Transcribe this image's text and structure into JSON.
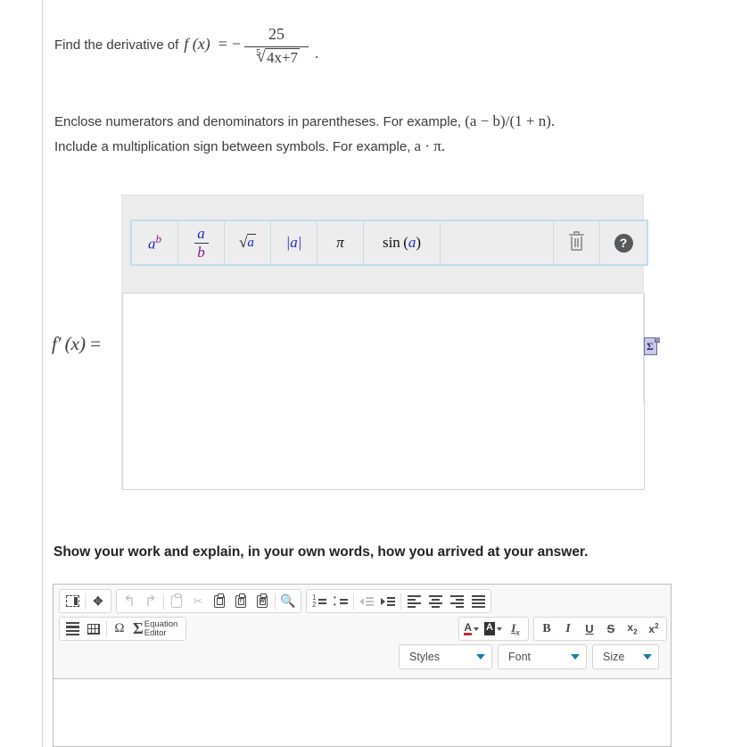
{
  "prompt": {
    "lead": "Find the derivative of",
    "function_name": "f (x)",
    "equals": "=",
    "minus": "−",
    "numerator": "25",
    "root_index": "5",
    "radicand": "4x+7",
    "period": "."
  },
  "instructions": {
    "line1_a": "Enclose numerators and denominators in parentheses. For example,",
    "line1_math": "(a − b)/(1 + n).",
    "line2_a": "Include a multiplication sign between symbols. For example,",
    "line2_math": "a · π."
  },
  "math_toolbar": {
    "buttons": [
      {
        "name": "power-button",
        "base": "a",
        "exp": "b"
      },
      {
        "name": "fraction-button",
        "num": "a",
        "den": "b"
      },
      {
        "name": "sqrt-button",
        "radicand": "a"
      },
      {
        "name": "absolute-value-button",
        "label": "|a|"
      },
      {
        "name": "pi-button",
        "label": "π"
      },
      {
        "name": "sine-button",
        "fn": "sin",
        "arg": "a"
      }
    ],
    "trash_label": "trash-icon",
    "help_label": "?"
  },
  "answer": {
    "label_f": "f",
    "label_prime": "′",
    "label_x": "(x)",
    "label_eq": "=",
    "value": "",
    "sigma_icon": "Σ"
  },
  "work": {
    "heading": "Show your work and explain, in your own words, how you arrived at your answer."
  },
  "editor": {
    "row1": [
      {
        "name": "source-button",
        "icon": "source"
      },
      {
        "name": "maximize-button",
        "icon": "maximize"
      },
      {
        "name": "undo-button",
        "icon": "←",
        "disabled": true
      },
      {
        "name": "redo-button",
        "icon": "→",
        "disabled": true
      },
      {
        "name": "copy-button",
        "icon": "copy",
        "disabled": true
      },
      {
        "name": "cut-button",
        "icon": "✂",
        "disabled": true
      },
      {
        "name": "paste-button",
        "icon": "paste"
      },
      {
        "name": "paste-as-text-button",
        "icon": "T"
      },
      {
        "name": "paste-from-word-button",
        "icon": "W"
      },
      {
        "name": "find-button",
        "icon": "🔍"
      },
      {
        "name": "numbered-list-button",
        "icon": "ol"
      },
      {
        "name": "bulleted-list-button",
        "icon": "ul"
      },
      {
        "name": "decrease-indent-button",
        "icon": "outdent",
        "disabled": true
      },
      {
        "name": "increase-indent-button",
        "icon": "indent"
      },
      {
        "name": "align-left-button",
        "icon": "align-left"
      },
      {
        "name": "align-center-button",
        "icon": "align-center"
      },
      {
        "name": "align-right-button",
        "icon": "align-right"
      },
      {
        "name": "justify-button",
        "icon": "justify"
      }
    ],
    "row2_left": [
      {
        "name": "horizontal-rule-button",
        "icon": "hr"
      },
      {
        "name": "table-button",
        "icon": "table"
      },
      {
        "name": "special-character-button",
        "icon": "Ω"
      },
      {
        "name": "equation-editor-button",
        "icon": "Σ",
        "label_line1": "Equation",
        "label_line2": "Editor"
      }
    ],
    "row2_right": [
      {
        "name": "text-color-button",
        "icon": "A"
      },
      {
        "name": "background-color-button",
        "icon": "A"
      },
      {
        "name": "remove-format-button",
        "icon": "Ix"
      },
      {
        "name": "bold-button",
        "icon": "B"
      },
      {
        "name": "italic-button",
        "icon": "I"
      },
      {
        "name": "underline-button",
        "icon": "U"
      },
      {
        "name": "strikethrough-button",
        "icon": "S"
      },
      {
        "name": "subscript-button",
        "icon": "x₂"
      },
      {
        "name": "superscript-button",
        "icon": "x²"
      }
    ],
    "combos": {
      "styles": "Styles",
      "font": "Font",
      "size": "Size"
    },
    "body_value": ""
  },
  "colors": {
    "accent_blue": "#2222cc",
    "accent_purple": "#8b1a8b",
    "toolbar_border": "#bfdfec",
    "panel_bg": "#ececec",
    "caret_blue": "#1a7ba8",
    "text": "#3b3b3b"
  }
}
